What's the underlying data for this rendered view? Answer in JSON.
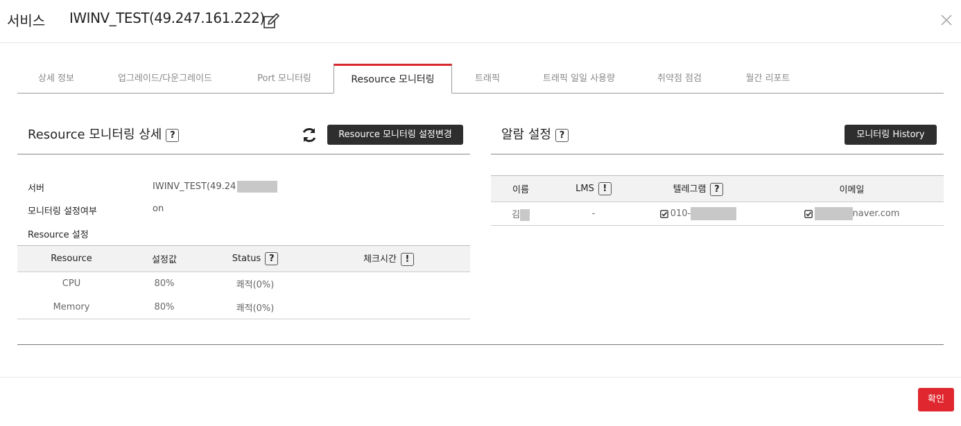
{
  "header": {
    "service_label": "서비스",
    "title": "IWINV_TEST(49.247.161.222)"
  },
  "tabs": [
    {
      "label": "상세 정보"
    },
    {
      "label": "업그레이드/다운그레이드"
    },
    {
      "label": "Port 모니터링"
    },
    {
      "label": "Resource 모니터링"
    },
    {
      "label": "트래픽"
    },
    {
      "label": "트래픽 일일 사용량"
    },
    {
      "label": "취약점 점검"
    },
    {
      "label": "월간 리포트"
    }
  ],
  "resource_panel": {
    "title": "Resource 모니터링 상세",
    "help": "?",
    "settings_button": "Resource 모니터링 설정변경",
    "server_label": "서버",
    "server_value": "IWINV_TEST(49.24",
    "monitoring_label": "모니터링 설정여부",
    "monitoring_value": "on",
    "resource_settings_label": "Resource 설정",
    "table": {
      "headers": [
        "Resource",
        "설정값",
        "Status",
        "체크시간"
      ],
      "status_help": "?",
      "check_time_help": "!",
      "rows": [
        [
          "CPU",
          "80%",
          "쾌적(0%)",
          ""
        ],
        [
          "Memory",
          "80%",
          "쾌적(0%)",
          ""
        ]
      ]
    }
  },
  "alarm_panel": {
    "title": "알람 설정",
    "help": "?",
    "history_button": "모니터링 History",
    "table": {
      "headers": [
        "이름",
        "LMS",
        "텔레그램",
        "이메일"
      ],
      "lms_help": "!",
      "telegram_help": "?",
      "row": {
        "name": "김",
        "lms": "-",
        "telegram": "010-",
        "email": "naver.com"
      }
    }
  },
  "footer": {
    "confirm_button": "확인"
  },
  "colors": {
    "accent": "#d9262c",
    "confirm": "#e0262e",
    "dark_button": "#2e2e2e"
  }
}
